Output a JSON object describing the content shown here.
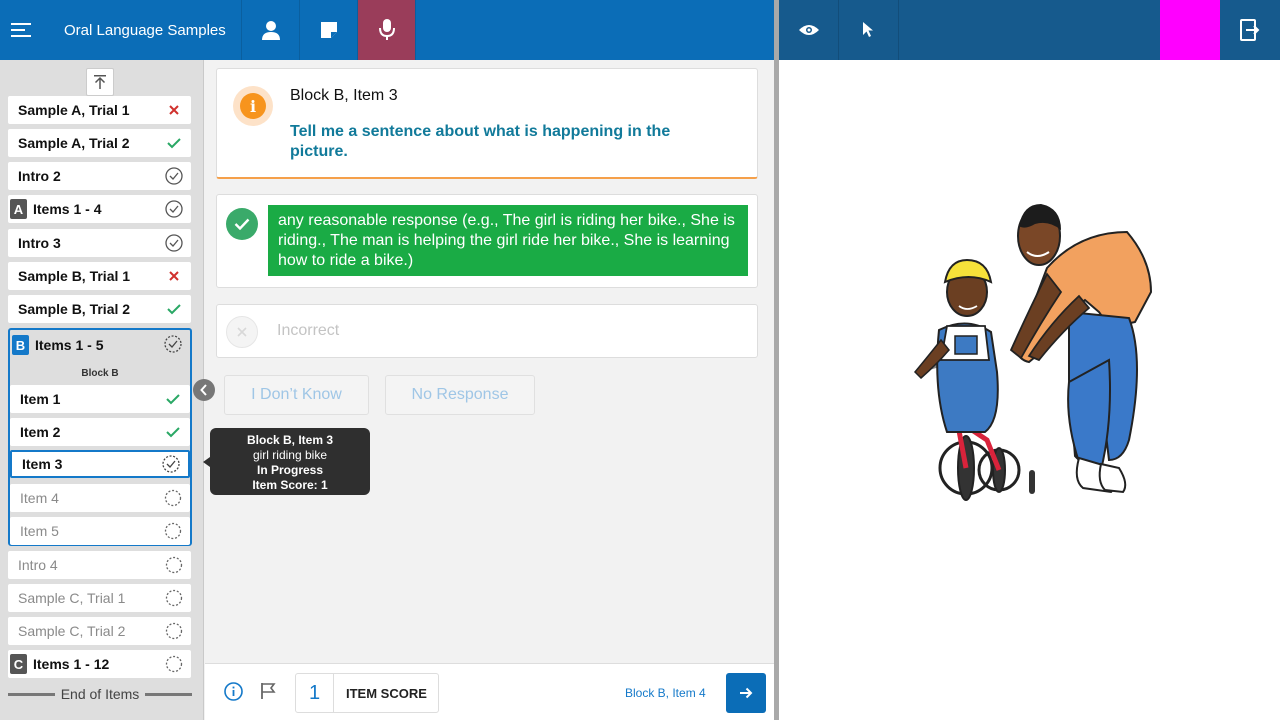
{
  "header": {
    "title": "Oral Language Samples",
    "icons": [
      "menu-icon",
      "person-icon",
      "note-icon",
      "microphone-icon"
    ],
    "right_icons": [
      "eye-icon",
      "pointer-icon",
      "exit-icon"
    ],
    "colors": {
      "bar": "#0b6db7",
      "bar_right": "#165a8d",
      "mic_active": "#9a3d5a",
      "marker": "#ff00ff"
    }
  },
  "sidebar": {
    "items": [
      {
        "label": "Sample A, Trial 1",
        "status": "incorrect"
      },
      {
        "label": "Sample A, Trial 2",
        "status": "correct"
      },
      {
        "label": "Intro 2",
        "status": "complete"
      },
      {
        "letter": "A",
        "label": "Items 1 - 4",
        "status": "complete"
      },
      {
        "label": "Intro 3",
        "status": "complete"
      },
      {
        "label": "Sample B, Trial 1",
        "status": "incorrect"
      },
      {
        "label": "Sample B, Trial 2",
        "status": "correct"
      }
    ],
    "block_b": {
      "letter": "B",
      "label": "Items 1 - 5",
      "sublabel": "Block B",
      "items": [
        {
          "label": "Item 1",
          "status": "correct"
        },
        {
          "label": "Item 2",
          "status": "correct"
        },
        {
          "label": "Item 3",
          "status": "in-progress"
        },
        {
          "label": "Item 4",
          "status": "pending"
        },
        {
          "label": "Item 5",
          "status": "pending"
        }
      ]
    },
    "after": [
      {
        "label": "Intro 4",
        "status": "pending"
      },
      {
        "label": "Sample C, Trial 1",
        "status": "pending"
      },
      {
        "label": "Sample C, Trial 2",
        "status": "pending"
      },
      {
        "letter": "C",
        "label": "Items 1 - 12",
        "status": "pending"
      }
    ],
    "end_label": "End of Items"
  },
  "tooltip": {
    "title": "Block B, Item 3",
    "subtitle": "girl riding bike",
    "status": "In Progress",
    "score": "Item Score: 1"
  },
  "question": {
    "title": "Block B, Item 3",
    "prompt": "Tell me a sentence about what is happening in the picture."
  },
  "answer": {
    "correct_text": "any reasonable response (e.g., The girl is riding her bike., She is riding., The man is helping the girl ride her bike., She is learning how to ride a bike.)",
    "incorrect_label": "Incorrect"
  },
  "options": {
    "dont_know": "I Don’t Know",
    "no_response": "No Response"
  },
  "footer": {
    "score": "1",
    "score_label": "ITEM SCORE",
    "next_label": "Block B, Item 4"
  }
}
